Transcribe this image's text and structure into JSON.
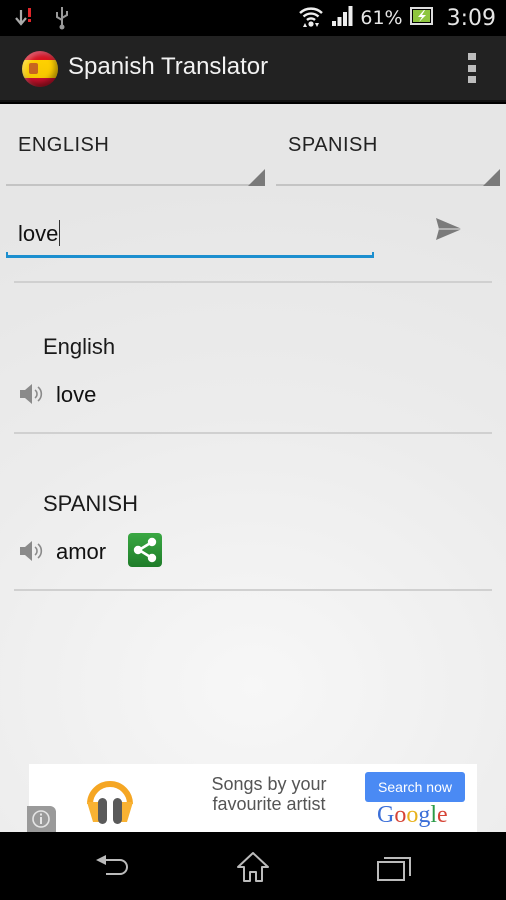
{
  "status_bar": {
    "icons_left": [
      "download-error-icon",
      "usb-icon"
    ],
    "icons_right": [
      "wifi-icon",
      "signal-icon",
      "battery-charging-icon"
    ],
    "battery": "61%",
    "time": "3:09"
  },
  "action_bar": {
    "app_icon": "spain-flag-icon",
    "title": "Spanish Translator",
    "overflow_icon": "overflow-menu-icon"
  },
  "translator": {
    "source_language": "ENGLISH",
    "target_language": "SPANISH",
    "input_value": "love",
    "send_icon": "send-icon"
  },
  "results": [
    {
      "label": "English",
      "text": "love",
      "speaker_icon": "speaker-icon"
    },
    {
      "label": "SPANISH",
      "text": "amor",
      "speaker_icon": "speaker-icon",
      "share_icon": "share-icon"
    }
  ],
  "ad": {
    "icon": "headphones-icon",
    "text_line1": "Songs by your",
    "text_line2": "favourite artist",
    "button_label": "Search now",
    "brand": [
      "G",
      "o",
      "o",
      "g",
      "l",
      "e"
    ],
    "brand_colors": [
      "#3b6fd8",
      "#d64436",
      "#e8b21c",
      "#3b6fd8",
      "#2a9a47",
      "#d64436"
    ],
    "info_icon": "info-icon"
  },
  "nav_bar": {
    "back_icon": "back-icon",
    "home_icon": "home-icon",
    "recents_icon": "recent-apps-icon"
  },
  "colors": {
    "accent": "#1c8fcf",
    "action_bar": "#222222",
    "share_green": "#2e9639"
  }
}
